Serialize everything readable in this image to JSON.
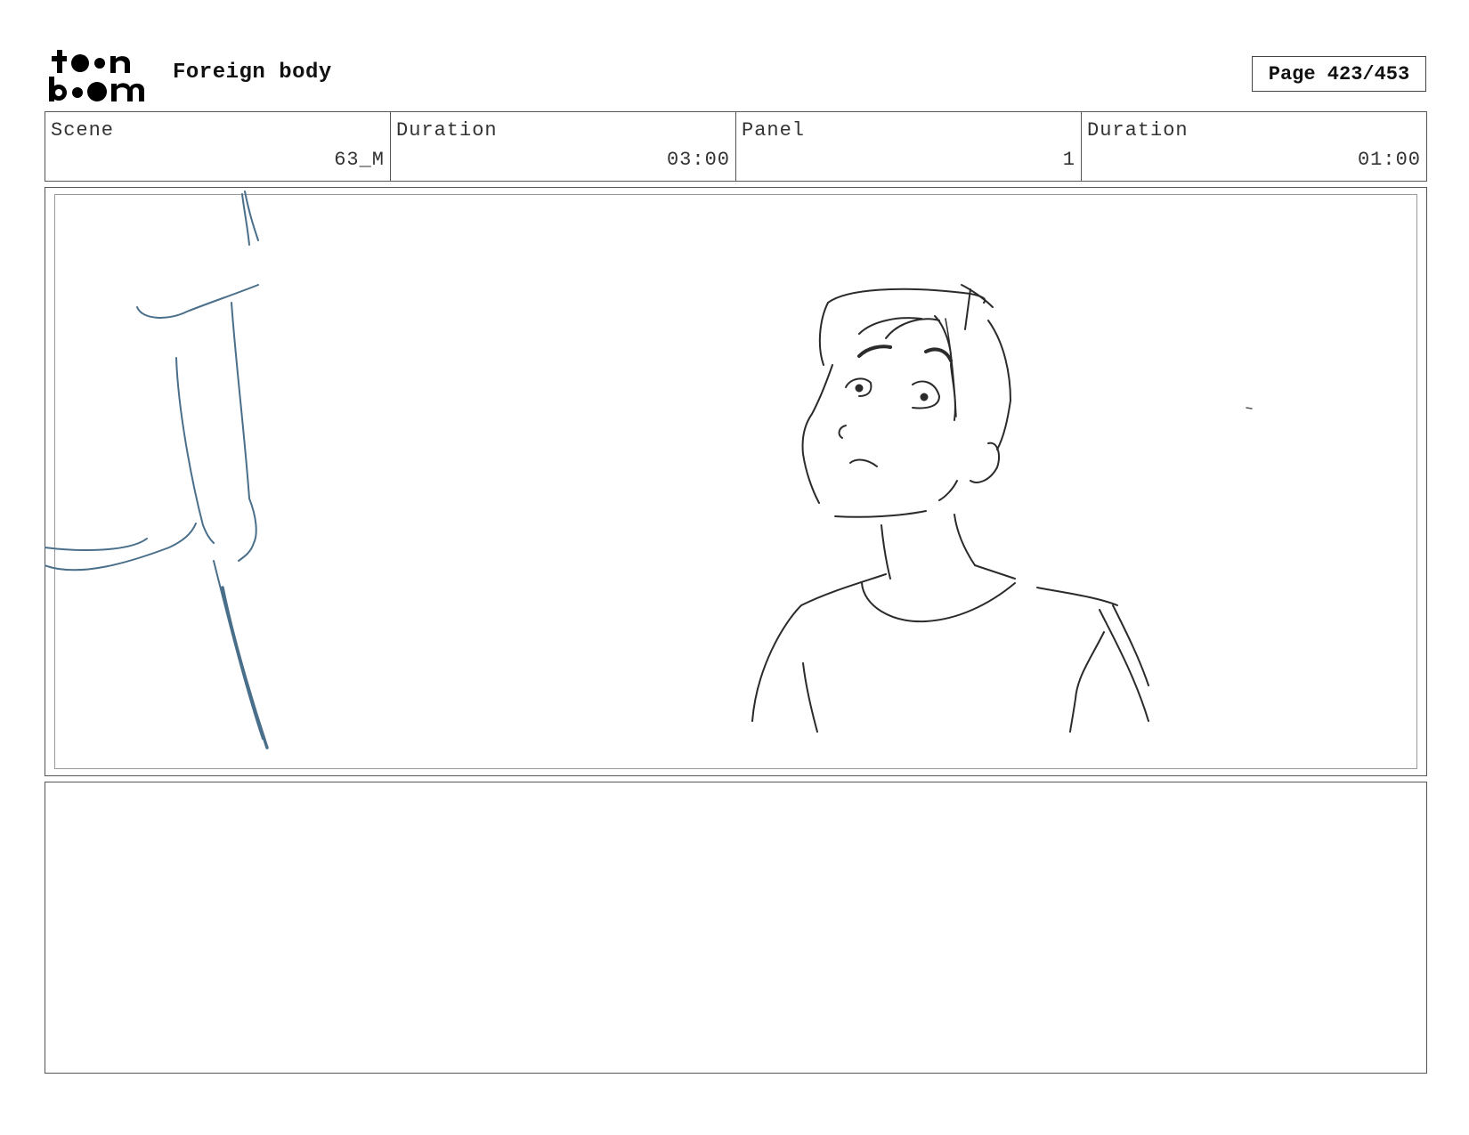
{
  "header": {
    "logo_text": "toon boom",
    "project_title": "Foreign body",
    "page_indicator": "Page 423/453"
  },
  "info_table": [
    {
      "label": "Scene",
      "value": "63_M"
    },
    {
      "label": "Duration",
      "value": "03:00"
    },
    {
      "label": "Panel",
      "value": "1"
    },
    {
      "label": "Duration",
      "value": "01:00"
    }
  ],
  "panel": {
    "sketch_subject": "boy looking up at a tall figure",
    "sketch_colors": {
      "figure_left": "#4a6f8a",
      "boy": "#2b2b2b"
    }
  },
  "notes": {
    "text": ""
  }
}
